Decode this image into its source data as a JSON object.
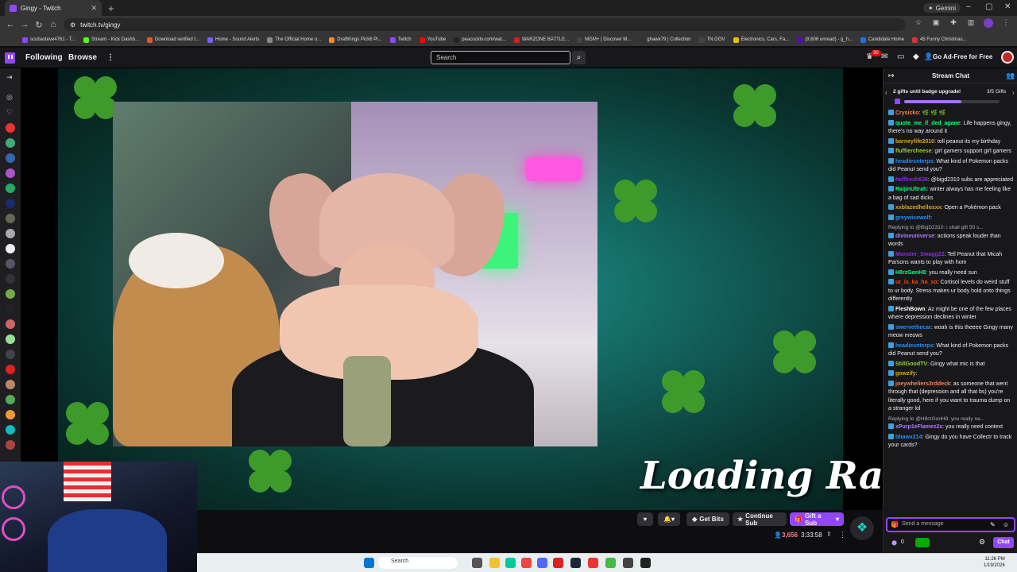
{
  "browser": {
    "tab_title": "Gingy - Twitch",
    "url": "twitch.tv/gingy",
    "gemini_label": "Gemini",
    "bookmarks": [
      {
        "label": "scubasteve4761 - T...",
        "color": "#9146ff"
      },
      {
        "label": "Stream - Kick Dashb...",
        "color": "#53fc18"
      },
      {
        "label": "Download verified t...",
        "color": "#e0582b"
      },
      {
        "label": "Home - Sound Alerts",
        "color": "#7b5cff"
      },
      {
        "label": "The Official Home o...",
        "color": "#888888"
      },
      {
        "label": "DraftKings Pick6 Pi...",
        "color": "#f28c28"
      },
      {
        "label": "Twitch",
        "color": "#9146ff"
      },
      {
        "label": "YouTube",
        "color": "#ff0000"
      },
      {
        "label": "peacocktv.com/wat...",
        "color": "#222222"
      },
      {
        "label": "WARZONE BATTLE...",
        "color": "#cc2222"
      },
      {
        "label": "MGM+ | Discover M...",
        "color": "#444444"
      },
      {
        "label": "ghawk79 | Collection",
        "color": "#333333"
      },
      {
        "label": "TN.GOV",
        "color": "#444444"
      },
      {
        "label": "Electronics, Cars, Fa...",
        "color": "#e5c100"
      },
      {
        "label": "(9,606 unread) - g_h...",
        "color": "#6001d2"
      },
      {
        "label": "Candidate Home",
        "color": "#1a73e8"
      },
      {
        "label": "45 Funny Christmas...",
        "color": "#d33"
      }
    ]
  },
  "twitch_nav": {
    "following": "Following",
    "browse": "Browse",
    "more": "⋮",
    "search_placeholder": "Search",
    "notif_count": "30",
    "ad_free": "Go Ad-Free for Free"
  },
  "player": {
    "overlay_text": "Loading Raid"
  },
  "below_player": {
    "get_bits": "Get Bits",
    "continue_sub": "Continue Sub",
    "gift_sub": "Gift a Sub",
    "viewers": "3,656",
    "uptime": "3:33:58"
  },
  "chat": {
    "title": "Stream Chat",
    "gift_goal": "2 gifts until badge upgrade!",
    "gift_progress_text": "3/5 Gifts",
    "gift_progress": 0.6,
    "messages": [
      {
        "user": "Crysicko",
        "color": "#ff7f50",
        "text": " 🌿 🌿 🌿"
      },
      {
        "user": "quote_me_if_ded_agane",
        "color": "#00ff7f",
        "text": " Life happens gingy, there's no way around it"
      },
      {
        "user": "barneyfife2010",
        "color": "#daa520",
        "text": " tell peanut its my birthday"
      },
      {
        "user": "fluffiercheese",
        "color": "#9acd32",
        "text": " girl gamers support girl gamers"
      },
      {
        "user": "headiesnterps",
        "color": "#1e90ff",
        "text": " What kind of Pokemon packs did Peanut send you?"
      },
      {
        "user": "hellfresh636",
        "color": "#8a2be2",
        "text": " @bigd2310 subs are appreciated"
      },
      {
        "user": "RaijinUltrah",
        "color": "#00ff7f",
        "text": " winter always has me feeling like a bag of sad dicks"
      },
      {
        "user": "xxblazedhellosxx",
        "color": "#daa520",
        "text": " Open a Pokémon pack"
      },
      {
        "user": "greywisewolf",
        "color": "#1e90ff",
        "text": " "
      },
      {
        "reply": "Replying to @BigD2310: i shall gift 50 s...",
        "user": "divineuniverse",
        "color": "#b07bff",
        "text": " actions speak louder than words"
      },
      {
        "user": "Monster_Swagg22",
        "color": "#8a2be2",
        "text": " Tell Peanut that Micah Parsons wants to play with hom"
      },
      {
        "user": "H8rzGonH8",
        "color": "#00ff7f",
        "text": " you really need sun"
      },
      {
        "user": "ur_is_ka_ha_so",
        "color": "#ff4500",
        "text": " Cortisol levels do weird stuff to ur body. Stress makes ur body hold onto things differently"
      },
      {
        "user": "FleshBown",
        "color": "#ffffff",
        "text": " Az might be one of the few places where depression declines in winter"
      },
      {
        "user": "swervethecar",
        "color": "#1e90ff",
        "text": " woah is this theeee Gingy many meow meows"
      },
      {
        "user": "headiesnterps",
        "color": "#1e90ff",
        "text": " What kind of Pokemon packs did Peanut send you?"
      },
      {
        "user": "StillGoodTV",
        "color": "#9acd32",
        "text": " Gingy what mic is that"
      },
      {
        "user": "gowzify",
        "color": "#daa520",
        "text": " "
      },
      {
        "user": "joeywheliers3rddeck",
        "color": "#ff7f50",
        "text": " as someone that went through that (depression and all that bs) you're literally good, here if you want to trauma dump on a stranger lol"
      },
      {
        "reply": "Replying to @H8rzGonH8: you really ne...",
        "user": "xPurp1eFlamez2x",
        "color": "#b07bff",
        "text": " you really need context"
      },
      {
        "user": "bhawx214",
        "color": "#1e90ff",
        "text": " Gingy do you have Collectr to track your cards?"
      }
    ],
    "input_placeholder": "Send a message",
    "points": "0",
    "chat_button": "Chat"
  },
  "taskbar": {
    "search": "Search",
    "time": "11:26 PM",
    "date": "1/19/2026"
  }
}
